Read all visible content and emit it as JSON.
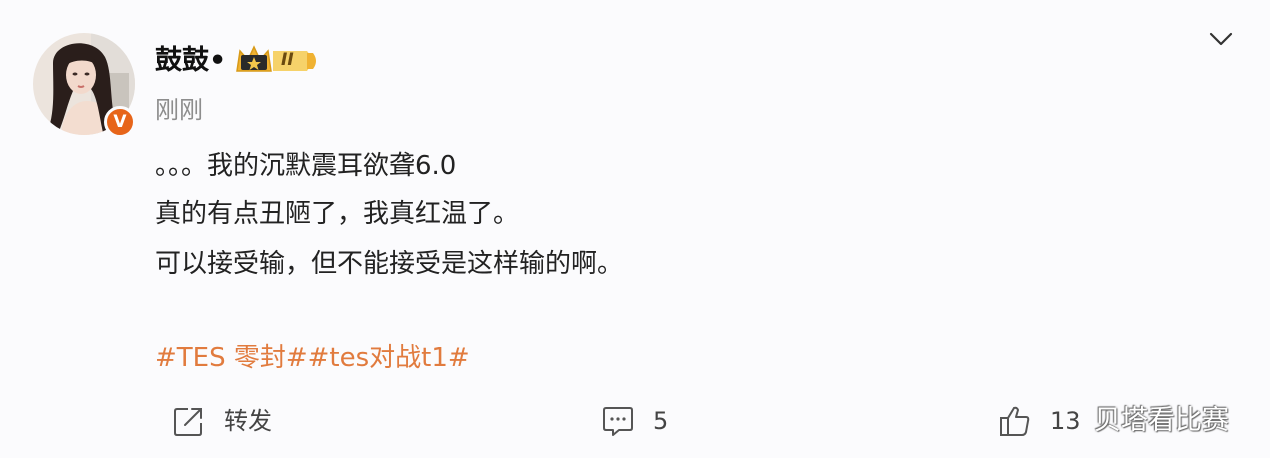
{
  "post": {
    "author": {
      "name": "鼓鼓•",
      "level_badge": "II",
      "verified_icon": "v-icon"
    },
    "timestamp": "刚刚",
    "content_lines": [
      "。。。我的沉默震耳欲聋6.0",
      "真的有点丑陋了，我真红温了。",
      "可以接受输，但不能接受是这样输的啊。"
    ],
    "hashtags": "#TES 零封##tes对战t1#",
    "actions": {
      "repost_label": "转发",
      "comment_count": "5",
      "like_count": "13"
    }
  },
  "watermark": "贝塔看比赛",
  "icons": {
    "menu": "chevron-down-icon",
    "repost": "share-icon",
    "comment": "comment-icon",
    "like": "thumbs-up-icon",
    "badge": "crown-icon"
  },
  "colors": {
    "hashtag": "#e17b3e",
    "verified": "#e7651a",
    "timestamp": "#8d8d8d",
    "badge_gold": "#f0b232"
  }
}
